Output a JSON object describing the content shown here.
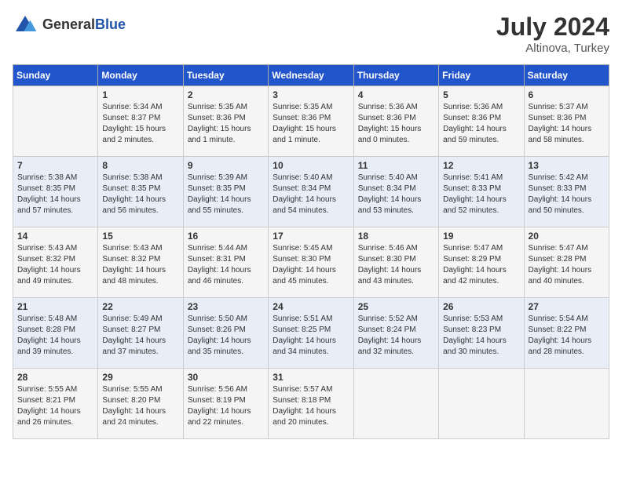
{
  "header": {
    "logo_general": "General",
    "logo_blue": "Blue",
    "month_year": "July 2024",
    "location": "Altinova, Turkey"
  },
  "days_of_week": [
    "Sunday",
    "Monday",
    "Tuesday",
    "Wednesday",
    "Thursday",
    "Friday",
    "Saturday"
  ],
  "weeks": [
    [
      {
        "day": "",
        "sunrise": "",
        "sunset": "",
        "daylight": ""
      },
      {
        "day": "1",
        "sunrise": "Sunrise: 5:34 AM",
        "sunset": "Sunset: 8:37 PM",
        "daylight": "Daylight: 15 hours and 2 minutes."
      },
      {
        "day": "2",
        "sunrise": "Sunrise: 5:35 AM",
        "sunset": "Sunset: 8:36 PM",
        "daylight": "Daylight: 15 hours and 1 minute."
      },
      {
        "day": "3",
        "sunrise": "Sunrise: 5:35 AM",
        "sunset": "Sunset: 8:36 PM",
        "daylight": "Daylight: 15 hours and 1 minute."
      },
      {
        "day": "4",
        "sunrise": "Sunrise: 5:36 AM",
        "sunset": "Sunset: 8:36 PM",
        "daylight": "Daylight: 15 hours and 0 minutes."
      },
      {
        "day": "5",
        "sunrise": "Sunrise: 5:36 AM",
        "sunset": "Sunset: 8:36 PM",
        "daylight": "Daylight: 14 hours and 59 minutes."
      },
      {
        "day": "6",
        "sunrise": "Sunrise: 5:37 AM",
        "sunset": "Sunset: 8:36 PM",
        "daylight": "Daylight: 14 hours and 58 minutes."
      }
    ],
    [
      {
        "day": "7",
        "sunrise": "Sunrise: 5:38 AM",
        "sunset": "Sunset: 8:35 PM",
        "daylight": "Daylight: 14 hours and 57 minutes."
      },
      {
        "day": "8",
        "sunrise": "Sunrise: 5:38 AM",
        "sunset": "Sunset: 8:35 PM",
        "daylight": "Daylight: 14 hours and 56 minutes."
      },
      {
        "day": "9",
        "sunrise": "Sunrise: 5:39 AM",
        "sunset": "Sunset: 8:35 PM",
        "daylight": "Daylight: 14 hours and 55 minutes."
      },
      {
        "day": "10",
        "sunrise": "Sunrise: 5:40 AM",
        "sunset": "Sunset: 8:34 PM",
        "daylight": "Daylight: 14 hours and 54 minutes."
      },
      {
        "day": "11",
        "sunrise": "Sunrise: 5:40 AM",
        "sunset": "Sunset: 8:34 PM",
        "daylight": "Daylight: 14 hours and 53 minutes."
      },
      {
        "day": "12",
        "sunrise": "Sunrise: 5:41 AM",
        "sunset": "Sunset: 8:33 PM",
        "daylight": "Daylight: 14 hours and 52 minutes."
      },
      {
        "day": "13",
        "sunrise": "Sunrise: 5:42 AM",
        "sunset": "Sunset: 8:33 PM",
        "daylight": "Daylight: 14 hours and 50 minutes."
      }
    ],
    [
      {
        "day": "14",
        "sunrise": "Sunrise: 5:43 AM",
        "sunset": "Sunset: 8:32 PM",
        "daylight": "Daylight: 14 hours and 49 minutes."
      },
      {
        "day": "15",
        "sunrise": "Sunrise: 5:43 AM",
        "sunset": "Sunset: 8:32 PM",
        "daylight": "Daylight: 14 hours and 48 minutes."
      },
      {
        "day": "16",
        "sunrise": "Sunrise: 5:44 AM",
        "sunset": "Sunset: 8:31 PM",
        "daylight": "Daylight: 14 hours and 46 minutes."
      },
      {
        "day": "17",
        "sunrise": "Sunrise: 5:45 AM",
        "sunset": "Sunset: 8:30 PM",
        "daylight": "Daylight: 14 hours and 45 minutes."
      },
      {
        "day": "18",
        "sunrise": "Sunrise: 5:46 AM",
        "sunset": "Sunset: 8:30 PM",
        "daylight": "Daylight: 14 hours and 43 minutes."
      },
      {
        "day": "19",
        "sunrise": "Sunrise: 5:47 AM",
        "sunset": "Sunset: 8:29 PM",
        "daylight": "Daylight: 14 hours and 42 minutes."
      },
      {
        "day": "20",
        "sunrise": "Sunrise: 5:47 AM",
        "sunset": "Sunset: 8:28 PM",
        "daylight": "Daylight: 14 hours and 40 minutes."
      }
    ],
    [
      {
        "day": "21",
        "sunrise": "Sunrise: 5:48 AM",
        "sunset": "Sunset: 8:28 PM",
        "daylight": "Daylight: 14 hours and 39 minutes."
      },
      {
        "day": "22",
        "sunrise": "Sunrise: 5:49 AM",
        "sunset": "Sunset: 8:27 PM",
        "daylight": "Daylight: 14 hours and 37 minutes."
      },
      {
        "day": "23",
        "sunrise": "Sunrise: 5:50 AM",
        "sunset": "Sunset: 8:26 PM",
        "daylight": "Daylight: 14 hours and 35 minutes."
      },
      {
        "day": "24",
        "sunrise": "Sunrise: 5:51 AM",
        "sunset": "Sunset: 8:25 PM",
        "daylight": "Daylight: 14 hours and 34 minutes."
      },
      {
        "day": "25",
        "sunrise": "Sunrise: 5:52 AM",
        "sunset": "Sunset: 8:24 PM",
        "daylight": "Daylight: 14 hours and 32 minutes."
      },
      {
        "day": "26",
        "sunrise": "Sunrise: 5:53 AM",
        "sunset": "Sunset: 8:23 PM",
        "daylight": "Daylight: 14 hours and 30 minutes."
      },
      {
        "day": "27",
        "sunrise": "Sunrise: 5:54 AM",
        "sunset": "Sunset: 8:22 PM",
        "daylight": "Daylight: 14 hours and 28 minutes."
      }
    ],
    [
      {
        "day": "28",
        "sunrise": "Sunrise: 5:55 AM",
        "sunset": "Sunset: 8:21 PM",
        "daylight": "Daylight: 14 hours and 26 minutes."
      },
      {
        "day": "29",
        "sunrise": "Sunrise: 5:55 AM",
        "sunset": "Sunset: 8:20 PM",
        "daylight": "Daylight: 14 hours and 24 minutes."
      },
      {
        "day": "30",
        "sunrise": "Sunrise: 5:56 AM",
        "sunset": "Sunset: 8:19 PM",
        "daylight": "Daylight: 14 hours and 22 minutes."
      },
      {
        "day": "31",
        "sunrise": "Sunrise: 5:57 AM",
        "sunset": "Sunset: 8:18 PM",
        "daylight": "Daylight: 14 hours and 20 minutes."
      },
      {
        "day": "",
        "sunrise": "",
        "sunset": "",
        "daylight": ""
      },
      {
        "day": "",
        "sunrise": "",
        "sunset": "",
        "daylight": ""
      },
      {
        "day": "",
        "sunrise": "",
        "sunset": "",
        "daylight": ""
      }
    ]
  ]
}
